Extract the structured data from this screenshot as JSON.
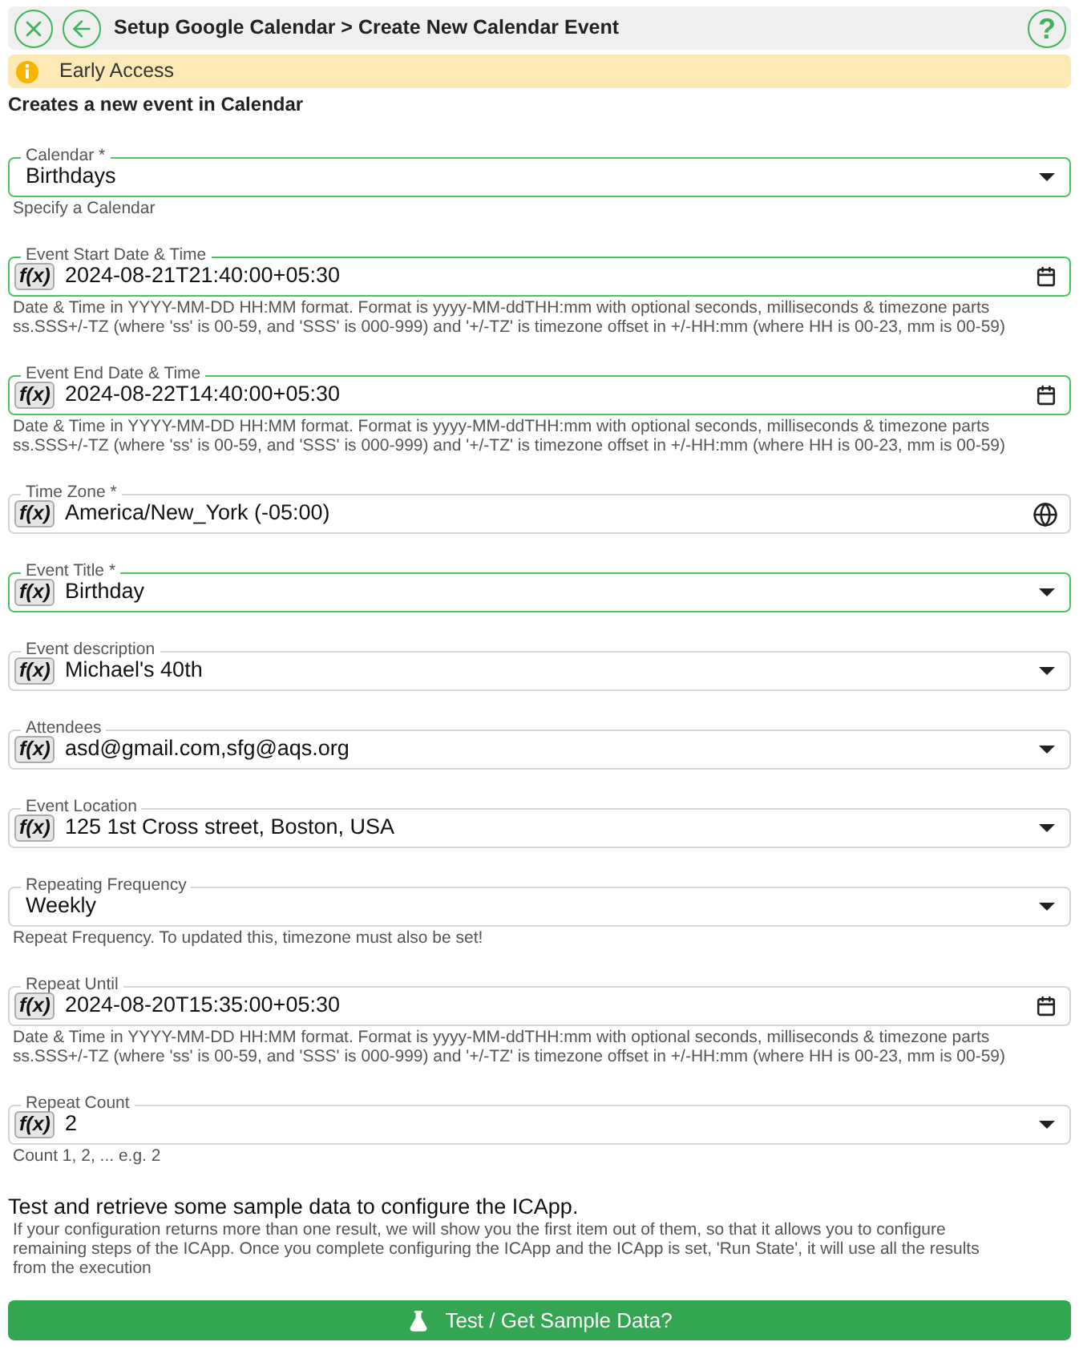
{
  "header": {
    "title": "Setup Google Calendar > Create New Calendar Event",
    "help": "?"
  },
  "notice": {
    "text": "Early Access"
  },
  "description": "Creates a new event in Calendar",
  "fields": [
    {
      "label": "Calendar *",
      "value": "Birthdays",
      "kind": "select",
      "highlighted": true,
      "helper": "Specify a Calendar"
    },
    {
      "label": "Event Start Date & Time",
      "value": "2024-08-21T21:40:00+05:30",
      "kind": "datetime",
      "formula": "f(x)",
      "highlighted": true,
      "helper": "Date & Time in YYYY-MM-DD HH:MM format. Format is yyyy-MM-ddTHH:mm with optional seconds, milliseconds & timezone parts ss.SSS+/-TZ (where 'ss' is 00-59, and 'SSS' is 000-999) and '+/-TZ' is timezone offset in +/-HH:mm (where HH is 00-23, mm is 00-59)"
    },
    {
      "label": "Event End Date & Time",
      "value": "2024-08-22T14:40:00+05:30",
      "kind": "datetime",
      "formula": "f(x)",
      "highlighted": true,
      "helper": "Date & Time in YYYY-MM-DD HH:MM format. Format is yyyy-MM-ddTHH:mm with optional seconds, milliseconds & timezone parts ss.SSS+/-TZ (where 'ss' is 00-59, and 'SSS' is 000-999) and '+/-TZ' is timezone offset in +/-HH:mm (where HH is 00-23, mm is 00-59)"
    },
    {
      "label": "Time Zone *",
      "value": "America/New_York (-05:00)",
      "kind": "timezone",
      "formula": "f(x)",
      "highlighted": false
    },
    {
      "label": "Event Title *",
      "value": "Birthday",
      "kind": "select",
      "formula": "f(x)",
      "highlighted": true
    },
    {
      "label": "Event description",
      "value": "Michael's 40th",
      "kind": "select",
      "formula": "f(x)",
      "highlighted": false
    },
    {
      "label": "Attendees",
      "value": "asd@gmail.com,sfg@aqs.org",
      "kind": "select",
      "formula": "f(x)",
      "highlighted": false
    },
    {
      "label": "Event Location",
      "value": "125 1st Cross street, Boston, USA",
      "kind": "select",
      "formula": "f(x)",
      "highlighted": false
    },
    {
      "label": "Repeating Frequency",
      "value": "Weekly",
      "kind": "select",
      "highlighted": false,
      "helper": "Repeat Frequency. To updated this, timezone must also be set!"
    },
    {
      "label": "Repeat Until",
      "value": "2024-08-20T15:35:00+05:30",
      "kind": "datetime",
      "formula": "f(x)",
      "highlighted": false,
      "helper": "Date & Time in YYYY-MM-DD HH:MM format. Format is yyyy-MM-ddTHH:mm with optional seconds, milliseconds & timezone parts ss.SSS+/-TZ (where 'ss' is 00-59, and 'SSS' is 000-999) and '+/-TZ' is timezone offset in +/-HH:mm (where HH is 00-23, mm is 00-59)"
    },
    {
      "label": "Repeat Count",
      "value": "2",
      "kind": "select",
      "formula": "f(x)",
      "highlighted": false,
      "helper": "Count 1, 2, ... e.g. 2"
    }
  ],
  "test": {
    "heading": "Test and retrieve some sample data to configure the ICApp.",
    "text": "If your configuration returns more than one result, we will show you the first item out of them, so that it allows you to configure remaining steps of the ICApp. Once you complete configuring the ICApp and the ICApp is set, 'Run State', it will use all the results from the execution",
    "button": "Test / Get Sample Data?"
  }
}
